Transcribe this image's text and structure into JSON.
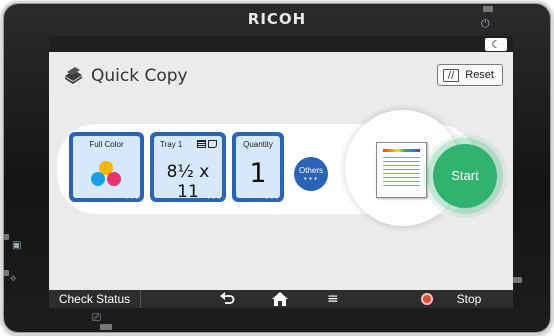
{
  "device": {
    "brand": "RICOH",
    "power_icon": "power-icon",
    "moon_icon": "☾",
    "usb_icon": "usb-icon",
    "bottom_icon": "sd-card-icon"
  },
  "header": {
    "title": "Quick Copy",
    "title_icon": "stacked-pages-icon",
    "reset_label": "Reset",
    "reset_icon": "//"
  },
  "tiles": {
    "color": {
      "label": "Full Color",
      "dots": "•••"
    },
    "paper": {
      "label": "Tray 1",
      "value": "8½ x 11",
      "dots": "•••"
    },
    "quantity": {
      "label": "Quantity",
      "value": "1",
      "dots": "•••"
    }
  },
  "others": {
    "label": "Others",
    "dots": "•••"
  },
  "start_label": "Start",
  "bottom_bar": {
    "check_status": "Check Status",
    "back_icon": "⮌",
    "home_icon": "🏠",
    "menu_icon": "≡",
    "stop_label": "Stop"
  },
  "colors": {
    "accent_blue": "#2a63b8",
    "tile_fill": "#d6e8fb",
    "start_green": "#2fb36f",
    "stop_red": "#e24d2c",
    "dot_yellow": "#f5b800",
    "dot_cyan": "#1aa0e6",
    "dot_magenta": "#e8336d"
  }
}
